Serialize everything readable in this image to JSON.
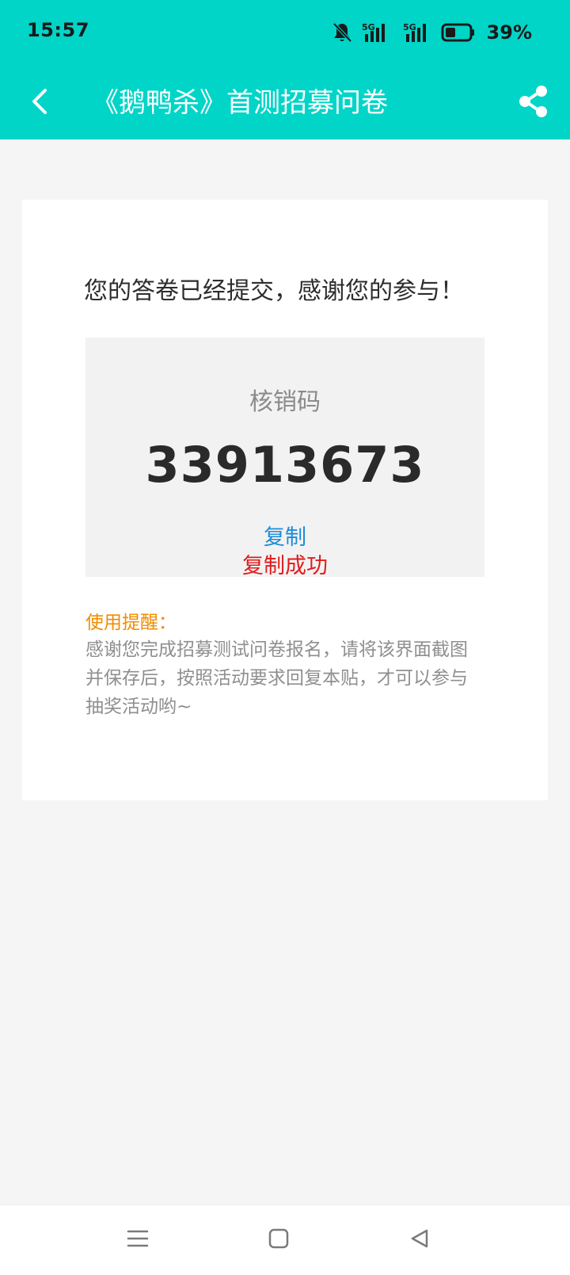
{
  "status_bar": {
    "time": "15:57",
    "battery": "39%",
    "icons": [
      "bell-off-icon",
      "signal-5g-icon",
      "signal-5g-icon",
      "battery-icon"
    ]
  },
  "app_bar": {
    "title": "《鹅鸭杀》首测招募问卷",
    "back_icon": "chevron-left-icon",
    "share_icon": "share-icon",
    "background_color": "#00d5c8"
  },
  "card": {
    "message": "您的答卷已经提交，感谢您的参与！",
    "code_box": {
      "label": "核销码",
      "code": "33913673",
      "copy_label": "复制",
      "copy_success": "复制成功"
    },
    "reminder": {
      "title": "使用提醒：",
      "text": "感谢您完成招募测试问卷报名，请将该界面截图并保存后，按照活动要求回复本贴，才可以参与抽奖活动哟~"
    }
  },
  "nav_bar": {
    "buttons": [
      "menu-icon",
      "home-icon",
      "back-triangle-icon"
    ]
  },
  "colors": {
    "accent": "#00d5c8",
    "link": "#1e8cd6",
    "success": "#e01b1b",
    "warning": "#f08c00"
  }
}
